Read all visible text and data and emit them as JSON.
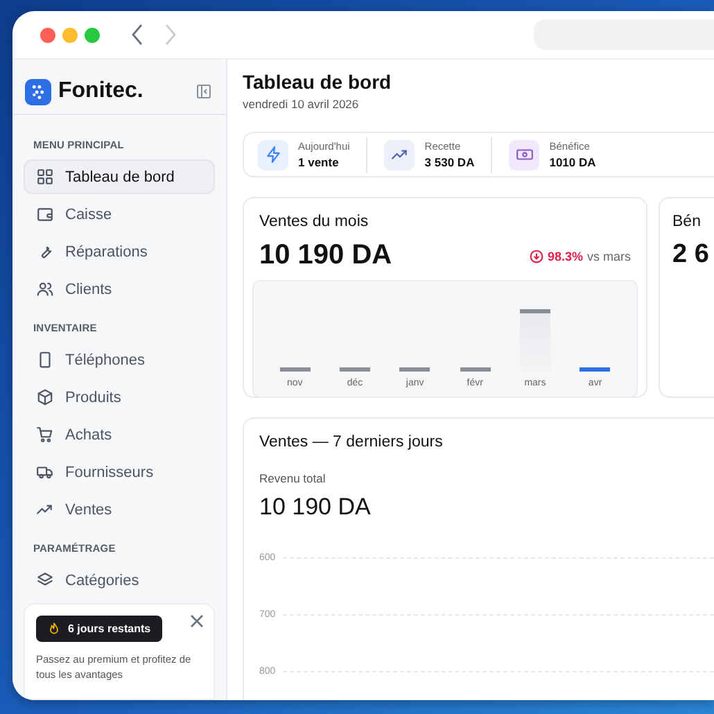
{
  "window": {
    "controls": [
      {
        "kind": "close"
      },
      {
        "kind": "minimize"
      },
      {
        "kind": "zoom"
      }
    ],
    "nav": [
      {
        "kind": "back",
        "disabled": false
      },
      {
        "kind": "forward",
        "disabled": true
      }
    ]
  },
  "sidebar": {
    "brand": "Fonitec.",
    "sections": [
      {
        "title": "MENU PRINCIPAL",
        "items": [
          {
            "label": "Tableau de bord",
            "selected": true
          },
          {
            "label": "Caisse",
            "selected": false
          },
          {
            "label": "Réparations",
            "selected": false
          },
          {
            "label": "Clients",
            "selected": false
          }
        ]
      },
      {
        "title": "INVENTAIRE",
        "items": [
          {
            "label": "Téléphones",
            "selected": false
          },
          {
            "label": "Produits",
            "selected": false
          },
          {
            "label": "Achats",
            "selected": false
          },
          {
            "label": "Fournisseurs",
            "selected": false
          },
          {
            "label": "Ventes",
            "selected": false
          }
        ]
      },
      {
        "title": "PARAMÉTRAGE",
        "items": [
          {
            "label": "Catégories",
            "selected": false
          }
        ]
      }
    ],
    "promo": {
      "badge": "6 jours restants",
      "text": "Passez au premium et profitez de tous les avantages"
    }
  },
  "header": {
    "title": "Tableau de bord",
    "date": "vendredi 10 avril 2026"
  },
  "stats": [
    {
      "label": "Aujourd'hui",
      "value": "1 vente"
    },
    {
      "label": "Recette",
      "value": "3 530 DA"
    },
    {
      "label": "Bénéfice",
      "value": "1010 DA"
    }
  ],
  "month_card": {
    "title": "Ventes du mois",
    "total": "10 190 DA",
    "change": "98.3%",
    "change_note": "vs mars",
    "months": [
      {
        "label": "nov",
        "selected": false
      },
      {
        "label": "déc",
        "selected": false
      },
      {
        "label": "janv",
        "selected": false
      },
      {
        "label": "févr",
        "selected": false
      },
      {
        "label": "mars",
        "selected": false
      },
      {
        "label": "avr",
        "selected": true
      }
    ]
  },
  "side_card": {
    "title": "Bén",
    "total": "2 6"
  },
  "week_card": {
    "title": "Ventes — 7 derniers jours",
    "subtitle": "Revenu total",
    "total": "10 190 DA",
    "ticks": [
      "600",
      "700",
      "800"
    ]
  }
}
